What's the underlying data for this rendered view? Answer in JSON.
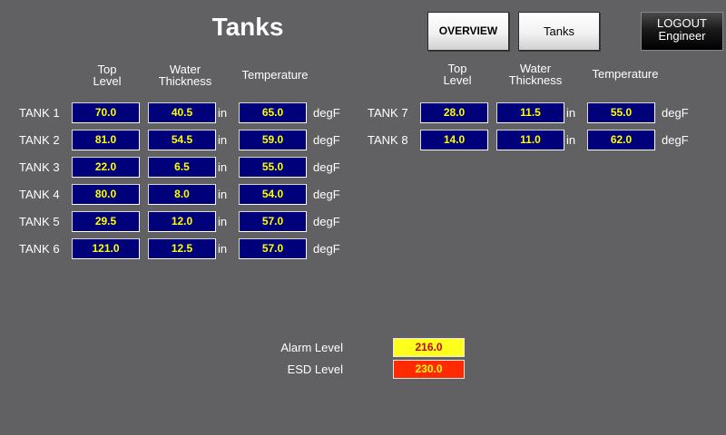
{
  "header": {
    "title": "Tanks",
    "overview_label": "OVERVIEW",
    "tanks_label": "Tanks",
    "logout_label": "LOGOUT",
    "logout_user": "Engineer"
  },
  "columns": {
    "top_level": [
      "Top",
      "Level"
    ],
    "water_thickness": [
      "Water",
      "Thickness"
    ],
    "temperature": "Temperature"
  },
  "units": {
    "thickness": "in",
    "temperature": "degF"
  },
  "tanks": [
    {
      "name": "TANK 1",
      "top_level": "70.0",
      "water_thickness": "40.5",
      "temperature": "65.0"
    },
    {
      "name": "TANK 2",
      "top_level": "81.0",
      "water_thickness": "54.5",
      "temperature": "59.0"
    },
    {
      "name": "TANK 3",
      "top_level": "22.0",
      "water_thickness": "6.5",
      "temperature": "55.0"
    },
    {
      "name": "TANK 4",
      "top_level": "80.0",
      "water_thickness": "8.0",
      "temperature": "54.0"
    },
    {
      "name": "TANK 5",
      "top_level": "29.5",
      "water_thickness": "12.0",
      "temperature": "57.0"
    },
    {
      "name": "TANK 6",
      "top_level": "121.0",
      "water_thickness": "12.5",
      "temperature": "57.0"
    },
    {
      "name": "TANK 7",
      "top_level": "28.0",
      "water_thickness": "11.5",
      "temperature": "55.0"
    },
    {
      "name": "TANK 8",
      "top_level": "14.0",
      "water_thickness": "11.0",
      "temperature": "62.0"
    }
  ],
  "limits": {
    "alarm_label": "Alarm Level",
    "alarm_value": "216.0",
    "alarm_color": "#ffff1e",
    "esd_label": "ESD Level",
    "esd_value": "230.0",
    "esd_color": "#ff2a00"
  },
  "colors": {
    "background": "#616062",
    "field_bg": "#00007b",
    "field_text": "#ffff00"
  }
}
